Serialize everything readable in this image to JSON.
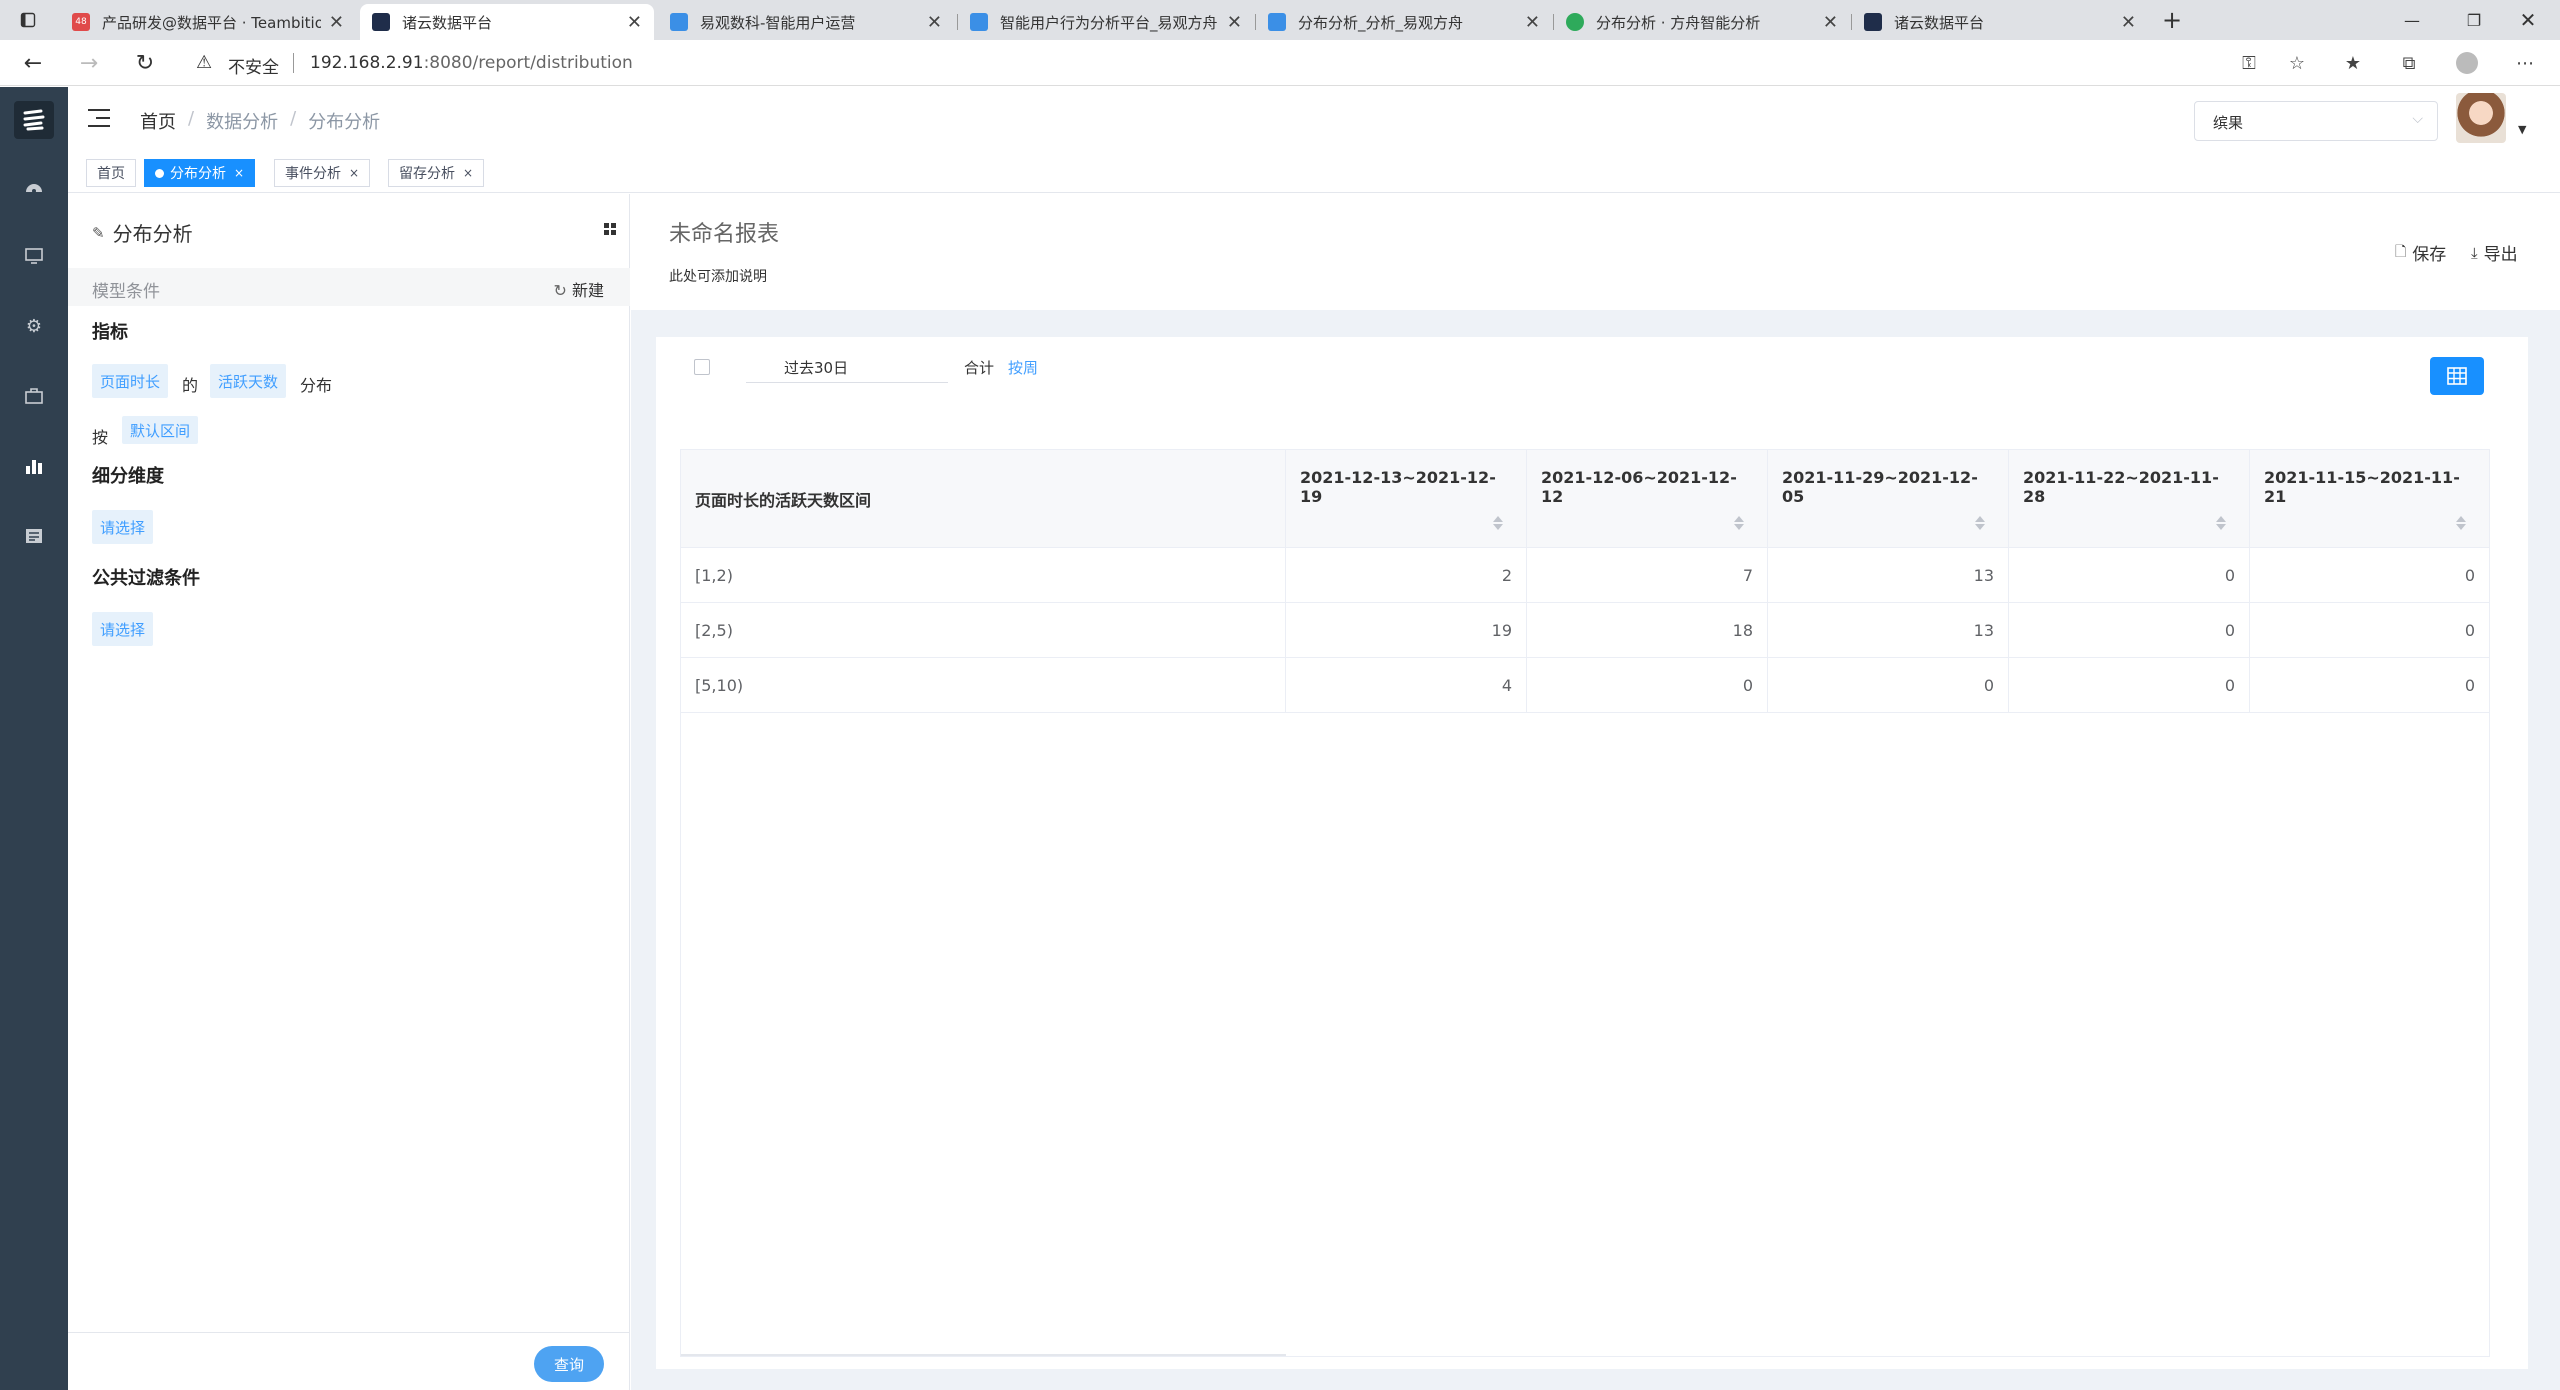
{
  "browser": {
    "tabs": [
      {
        "title": "产品研发@数据平台 · Teambition",
        "favicon_color": "#e04a4a",
        "badge": "48"
      },
      {
        "title": "诸云数据平台",
        "favicon_color": "#1f2d4a",
        "active": true
      },
      {
        "title": "易观数科-智能用户运营",
        "favicon_color": "#3b8fe6"
      },
      {
        "title": "智能用户行为分析平台_易观方舟",
        "favicon_color": "#3b8fe6"
      },
      {
        "title": "分布分析_分析_易观方舟",
        "favicon_color": "#3b8fe6"
      },
      {
        "title": "分布分析 · 方舟智能分析",
        "favicon_color": "#2eaa5b"
      },
      {
        "title": "诸云数据平台",
        "favicon_color": "#1f2d4a"
      }
    ],
    "new_tab": "+",
    "insecure_label": "不安全",
    "url_host": "192.168.2.91",
    "url_path": ":8080/report/distribution"
  },
  "header": {
    "breadcrumb": [
      "首页",
      "数据分析",
      "分布分析"
    ],
    "workspace": "缤果"
  },
  "tagbar": {
    "tags": [
      {
        "label": "首页",
        "closable": false,
        "active": false
      },
      {
        "label": "分布分析",
        "closable": true,
        "active": true
      },
      {
        "label": "事件分析",
        "closable": true,
        "active": false
      },
      {
        "label": "留存分析",
        "closable": true,
        "active": false
      }
    ],
    "close_glyph": "×"
  },
  "left_panel": {
    "title": "分布分析",
    "section_label": "模型条件",
    "new_label": "新建",
    "metric_heading": "指标",
    "metric_field": "页面时长",
    "of_text": "的",
    "metric_measure": "活跃天数",
    "distribution_text": "分布",
    "by_text": "按",
    "interval": "默认区间",
    "breakdown_heading": "细分维度",
    "breakdown_select": "请选择",
    "filter_heading": "公共过滤条件",
    "filter_select": "请选择",
    "query_button": "查询"
  },
  "report": {
    "title": "未命名报表",
    "description": "此处可添加说明",
    "save_label": "保存",
    "export_label": "导出",
    "date_range": "过去30日",
    "sum_label": "合计",
    "granularity": "按周"
  },
  "table": {
    "first_header": "页面时长的活跃天数区间",
    "columns": [
      "2021-12-13~2021-12-19",
      "2021-12-06~2021-12-12",
      "2021-11-29~2021-12-05",
      "2021-11-22~2021-11-28",
      "2021-11-15~2021-11-21"
    ],
    "rows": [
      {
        "label": "[1,2)",
        "values": [
          "2",
          "7",
          "13",
          "0",
          "0"
        ]
      },
      {
        "label": "[2,5)",
        "values": [
          "19",
          "18",
          "13",
          "0",
          "0"
        ]
      },
      {
        "label": "[5,10)",
        "values": [
          "4",
          "0",
          "0",
          "0",
          "0"
        ]
      }
    ]
  },
  "colors": {
    "accent": "#1890ff",
    "sidebar": "#30404f",
    "chip_bg": "#e6f1fb"
  }
}
